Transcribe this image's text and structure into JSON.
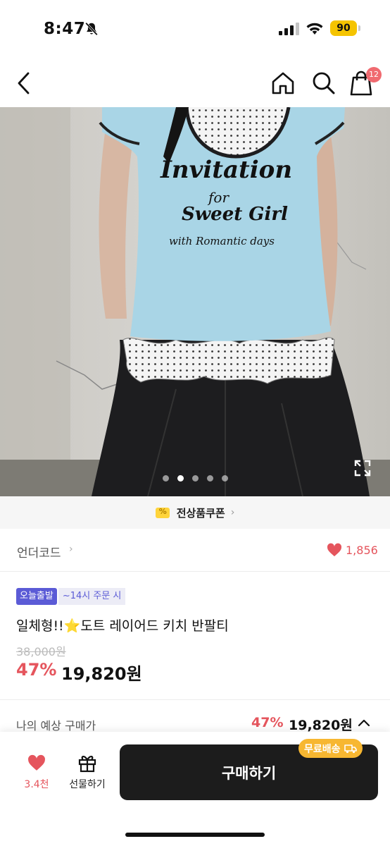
{
  "status_bar": {
    "time": "8:47",
    "battery": "90",
    "icons": [
      "bell-off-icon",
      "signal-icon",
      "wifi-icon",
      "battery-icon"
    ]
  },
  "nav": {
    "cart_count": "12",
    "icons": [
      "back-icon",
      "home-icon",
      "search-icon",
      "cart-icon"
    ]
  },
  "gallery": {
    "image_count": 5,
    "active_index": 1,
    "tshirt_print": [
      "Invitation",
      "for",
      "Sweet Girl",
      "with Romantic days"
    ]
  },
  "coupon": {
    "label": "전상품쿠폰",
    "chevron": "›"
  },
  "brand": {
    "name": "언더코드",
    "chevron": "›",
    "likes": "1,856"
  },
  "badges": {
    "today_shipping": "오늘출발",
    "cutoff": "~14시 주문 시"
  },
  "product": {
    "title": "일체형!!⭐도트 레이어드 키치 반팔티",
    "original_price": "38,000원",
    "discount_rate": "47%",
    "sale_price": "19,820원"
  },
  "expected_price": {
    "label": "나의 예상 구매가",
    "rate": "47%",
    "price": "19,820원"
  },
  "bottom_bar": {
    "wish_count": "3.4천",
    "gift_label": "선물하기",
    "buy_label": "구매하기",
    "shipping_badge": "무료배송"
  },
  "colors": {
    "accent_red": "#e5555d",
    "badge_purple": "#5b5bd6",
    "buy_button": "#1c1c1c",
    "shipping_badge": "#f7b731"
  }
}
